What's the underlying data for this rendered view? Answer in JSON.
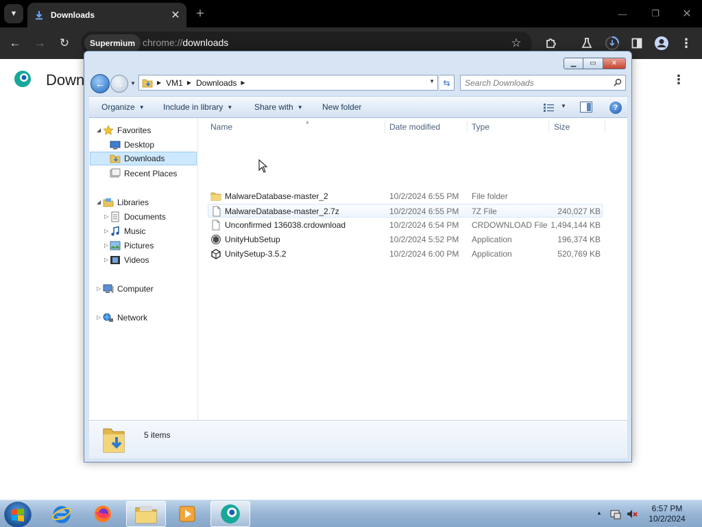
{
  "browser": {
    "tab_title": "Downloads",
    "site_chip": "Supermium",
    "url_scheme": "chrome://",
    "url_host": "downloads",
    "page_title": "Downloads"
  },
  "explorer": {
    "breadcrumbs": [
      "VM1",
      "Downloads"
    ],
    "search_placeholder": "Search Downloads",
    "toolbar": {
      "organize": "Organize",
      "include_in_library": "Include in library",
      "share_with": "Share with",
      "new_folder": "New folder"
    },
    "nav": {
      "favorites": "Favorites",
      "desktop": "Desktop",
      "downloads": "Downloads",
      "recent_places": "Recent Places",
      "libraries": "Libraries",
      "documents": "Documents",
      "music": "Music",
      "pictures": "Pictures",
      "videos": "Videos",
      "computer": "Computer",
      "network": "Network"
    },
    "columns": {
      "name": "Name",
      "date_modified": "Date modified",
      "type": "Type",
      "size": "Size"
    },
    "files": [
      {
        "name": "MalwareDatabase-master_2",
        "date": "10/2/2024 6:55 PM",
        "type": "File folder",
        "size": "",
        "icon": "folder-icon"
      },
      {
        "name": "MalwareDatabase-master_2.7z",
        "date": "10/2/2024 6:55 PM",
        "type": "7Z File",
        "size": "240,027 KB",
        "icon": "file-icon"
      },
      {
        "name": "Unconfirmed 136038.crdownload",
        "date": "10/2/2024 6:54 PM",
        "type": "CRDOWNLOAD File",
        "size": "1,494,144 KB",
        "icon": "file-icon"
      },
      {
        "name": "UnityHubSetup",
        "date": "10/2/2024 5:52 PM",
        "type": "Application",
        "size": "196,374 KB",
        "icon": "unity-hub-icon"
      },
      {
        "name": "UnitySetup-3.5.2",
        "date": "10/2/2024 6:00 PM",
        "type": "Application",
        "size": "520,769 KB",
        "icon": "unity-icon"
      }
    ],
    "status": "5 items"
  },
  "taskbar": {
    "time": "6:57 PM",
    "date": "10/2/2024"
  },
  "colors": {
    "chrome_dark": "#2b2b2b",
    "explorer_frame": "#d6e4f3",
    "selection": "#cde8ff",
    "taskbar": "#95b3d3"
  }
}
